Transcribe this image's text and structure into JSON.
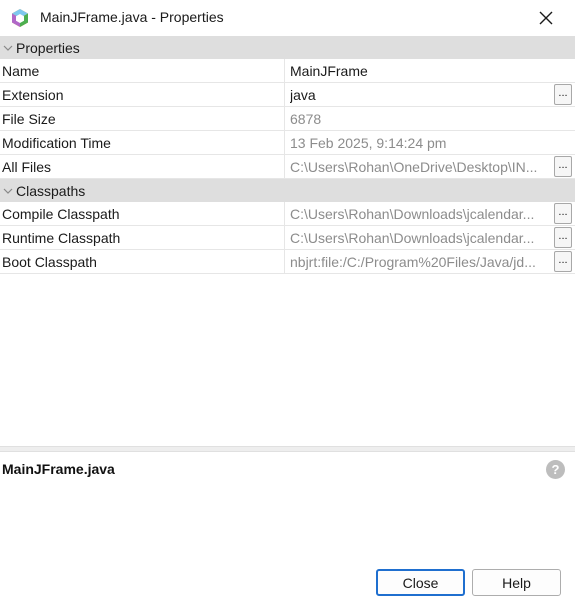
{
  "window": {
    "title": "MainJFrame.java - Properties",
    "icon": "netbeans-cube-icon"
  },
  "properties": {
    "category_label": "Properties",
    "rows": [
      {
        "name": "Name",
        "value": "MainJFrame"
      },
      {
        "name": "Extension",
        "value": "java",
        "button": "..."
      },
      {
        "name": "File Size",
        "value": "6878"
      },
      {
        "name": "Modification Time",
        "value": "13 Feb 2025, 9:14:24 pm"
      },
      {
        "name": "All Files",
        "value": "C:\\Users\\Rohan\\OneDrive\\Desktop\\IN...",
        "button": "..."
      }
    ]
  },
  "classpaths": {
    "category_label": "Classpaths",
    "rows": [
      {
        "name": "Compile Classpath",
        "value": "C:\\Users\\Rohan\\Downloads\\jcalendar...",
        "button": "..."
      },
      {
        "name": "Runtime Classpath",
        "value": "C:\\Users\\Rohan\\Downloads\\jcalendar...",
        "button": "..."
      },
      {
        "name": "Boot Classpath",
        "value": "nbjrt:file:/C:/Program%20Files/Java/jd...",
        "button": "..."
      }
    ]
  },
  "description": {
    "title": "MainJFrame.java",
    "help_glyph": "?"
  },
  "buttons": {
    "close_label": "Close",
    "help_label": "Help"
  },
  "colors": {
    "accent": "#1f6fcf",
    "category_bg": "#dedede",
    "readonly_text": "#8c8c8c"
  }
}
